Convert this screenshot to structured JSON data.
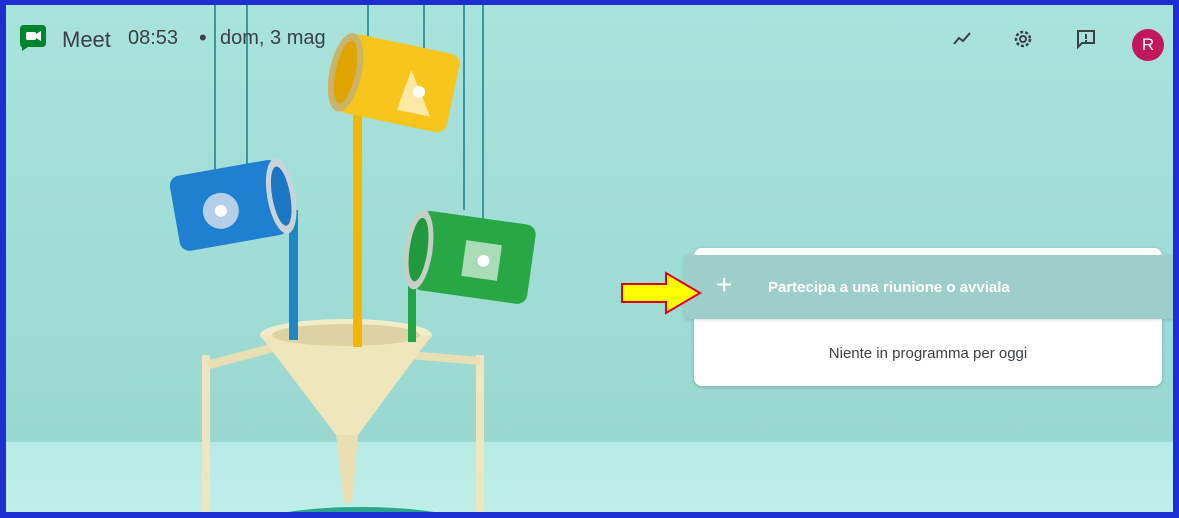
{
  "header": {
    "app_name": "Meet",
    "time": "08:53",
    "separator": "•",
    "date": "dom, 3 mag",
    "avatar_initial": "R"
  },
  "main": {
    "join_button_label": "Partecipa a una riunione o avviala",
    "join_button_icon": "+",
    "empty_schedule_text": "Niente in programma per oggi"
  },
  "colors": {
    "frame_border": "#1d2fd1",
    "background": "#a8e3dc",
    "avatar_bg": "#c2185b",
    "annotation_arrow": "#ffff00"
  },
  "icons": [
    "meet-logo-icon",
    "activity-chart-icon",
    "settings-gear-icon",
    "feedback-icon",
    "plus-icon",
    "annotation-arrow-icon"
  ]
}
